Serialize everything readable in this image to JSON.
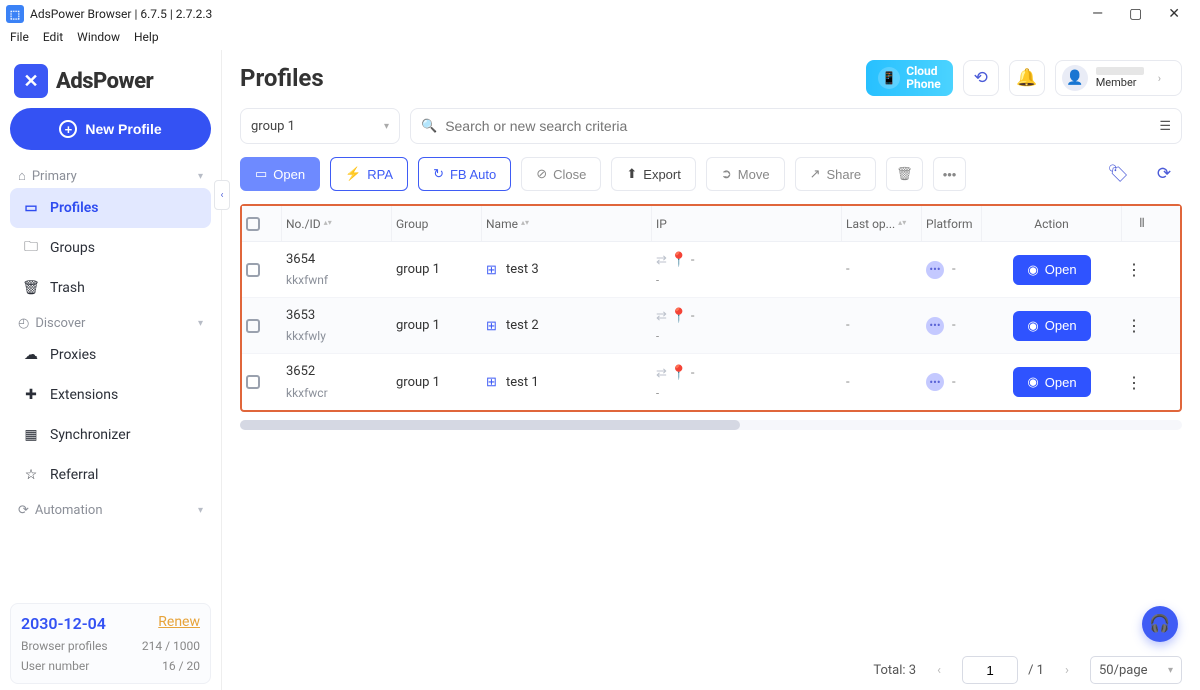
{
  "window": {
    "title": "AdsPower Browser | 6.7.5 | 2.7.2.3"
  },
  "menubar": [
    "File",
    "Edit",
    "Window",
    "Help"
  ],
  "brand": {
    "name": "AdsPower"
  },
  "sidebar": {
    "new_profile": "New Profile",
    "sections": {
      "primary": "Primary",
      "discover": "Discover",
      "automation": "Automation"
    },
    "primary_items": [
      {
        "label": "Profiles"
      },
      {
        "label": "Groups"
      },
      {
        "label": "Trash"
      }
    ],
    "discover_items": [
      {
        "label": "Proxies"
      },
      {
        "label": "Extensions"
      },
      {
        "label": "Synchronizer"
      },
      {
        "label": "Referral"
      }
    ],
    "license": {
      "date": "2030-12-04",
      "renew": "Renew",
      "profiles_label": "Browser profiles",
      "profiles_value": "214 / 1000",
      "users_label": "User number",
      "users_value": "16 / 20"
    }
  },
  "header": {
    "title": "Profiles",
    "cloudphone_l1": "Cloud",
    "cloudphone_l2": "Phone",
    "member_label": "Member"
  },
  "filters": {
    "group_selected": "group 1",
    "search_placeholder": "Search or new search criteria"
  },
  "toolbar": {
    "open": "Open",
    "rpa": "RPA",
    "fbauto": "FB Auto",
    "close": "Close",
    "export": "Export",
    "move": "Move",
    "share": "Share"
  },
  "table": {
    "headers": {
      "no": "No./ID",
      "group": "Group",
      "name": "Name",
      "ip": "IP",
      "lastop": "Last op...",
      "platform": "Platform",
      "action": "Action"
    },
    "rows": [
      {
        "no": "3654",
        "id": "kkxfwnf",
        "group": "group 1",
        "name": "test 3",
        "open": "Open"
      },
      {
        "no": "3653",
        "id": "kkxfwly",
        "group": "group 1",
        "name": "test 2",
        "open": "Open"
      },
      {
        "no": "3652",
        "id": "kkxfwcr",
        "group": "group 1",
        "name": "test 1",
        "open": "Open"
      }
    ]
  },
  "pagination": {
    "total_label": "Total: 3",
    "page": "1",
    "total_pages": "/ 1",
    "per_page": "50/page"
  }
}
